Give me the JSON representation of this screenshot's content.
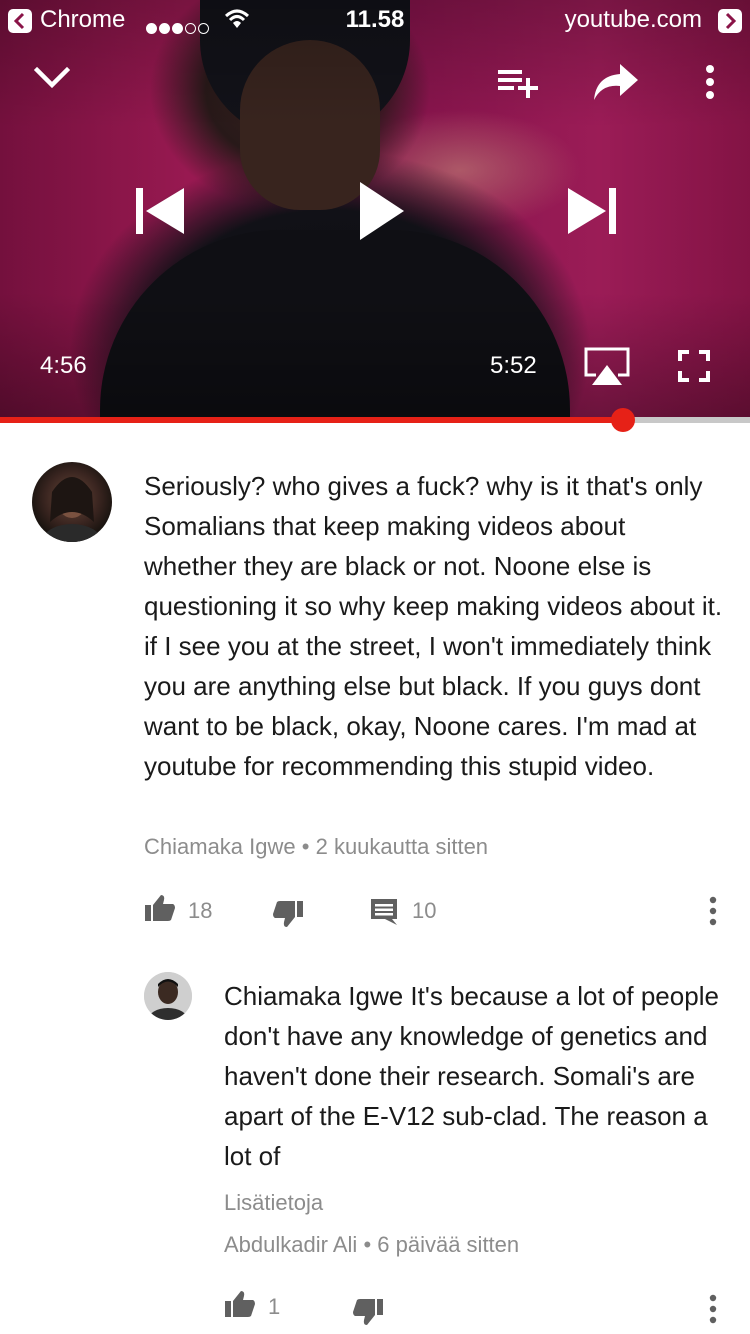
{
  "status_bar": {
    "app_name": "Chrome",
    "time": "11.58",
    "url": "youtube.com",
    "signal_bars": 3
  },
  "player": {
    "current_time": "4:56",
    "duration": "5:52",
    "progress_fraction": 0.83
  },
  "comments": [
    {
      "text": "Seriously? who gives a fuck? why is it that's only Somalians that keep making videos about whether they are black or not. Noone else is questioning it so why keep making videos about it. if I see you at the street,  I won't immediately think you are anything else but black. If you guys dont want to be black, okay,  Noone cares. I'm mad at youtube for recommending this stupid video.",
      "author": "Chiamaka Igwe",
      "time_ago": "2 kuukautta sitten",
      "likes": "18",
      "replies": "10"
    }
  ],
  "reply": {
    "text": "Chiamaka Igwe It's because a lot of people don't have any knowledge of genetics and haven't done their research.  Somali's are apart of the E-V12 sub-clad.  The reason a lot of",
    "read_more": "Lisätietoja",
    "author": "Abdulkadir Ali",
    "time_ago": "6 päivää sitten",
    "likes": "1"
  },
  "colors": {
    "accent": "#e62117",
    "meta_text": "#8c8c8c"
  }
}
